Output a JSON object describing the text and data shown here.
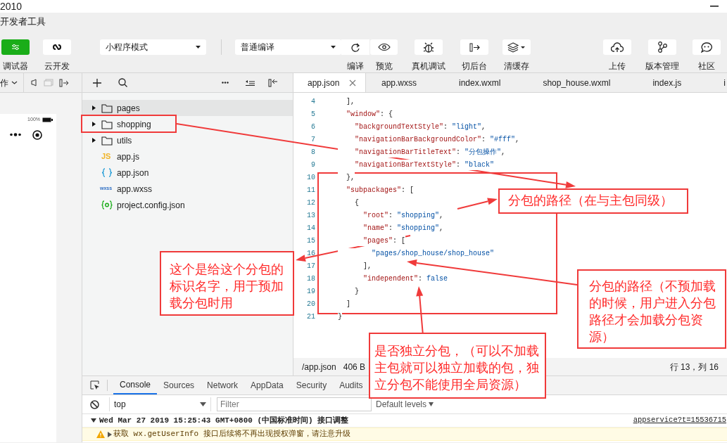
{
  "window": {
    "title": "2010",
    "app_title": "开发者工具"
  },
  "toolbar": {
    "toggles": [
      {
        "label": "调试器",
        "on": true
      },
      {
        "label": "云开发",
        "on": false
      }
    ],
    "mode_select": "小程序模式",
    "compile_select": "普通编译",
    "actions": [
      "编译",
      "预览",
      "真机调试",
      "切后台",
      "清缓存",
      "上传",
      "版本管理",
      "社区"
    ]
  },
  "simulator": {
    "header": "作",
    "battery": "100%"
  },
  "file_tree": {
    "items": [
      {
        "name": "pages",
        "kind": "folder",
        "expanded": false,
        "selected": true
      },
      {
        "name": "shopping",
        "kind": "folder",
        "expanded": false,
        "selected": false
      },
      {
        "name": "utils",
        "kind": "folder",
        "expanded": false,
        "selected": false
      },
      {
        "name": "app.js",
        "kind": "js",
        "icon_label": "JS",
        "selected": false
      },
      {
        "name": "app.json",
        "kind": "json",
        "selected": false
      },
      {
        "name": "app.wxss",
        "kind": "wxss",
        "icon_label": "wxss",
        "selected": false
      },
      {
        "name": "project.config.json",
        "kind": "config",
        "selected": false
      }
    ]
  },
  "editor": {
    "tabs": [
      {
        "label": "app.json",
        "selected": true
      },
      {
        "label": "app.wxss",
        "selected": false
      },
      {
        "label": "index.wxml",
        "selected": false
      },
      {
        "label": "shop_house.wxml",
        "selected": false
      },
      {
        "label": "index.js",
        "selected": false
      },
      {
        "label": "i",
        "selected": false
      }
    ],
    "lines": [
      {
        "number": "4",
        "tokens": [
          {
            "kind": "punct",
            "text": "  ],"
          }
        ]
      },
      {
        "number": "5",
        "tokens": [
          {
            "kind": "key",
            "text": "  \"window\""
          },
          {
            "kind": "punct",
            "text": ": {"
          }
        ]
      },
      {
        "number": "6",
        "tokens": [
          {
            "kind": "key",
            "text": "    \"backgroundTextStyle\""
          },
          {
            "kind": "punct",
            "text": ": "
          },
          {
            "kind": "string",
            "text": "\"light\""
          },
          {
            "kind": "punct",
            "text": ","
          }
        ]
      },
      {
        "number": "7",
        "tokens": [
          {
            "kind": "key",
            "text": "    \"navigationBarBackgroundColor\""
          },
          {
            "kind": "punct",
            "text": ": "
          },
          {
            "kind": "string",
            "text": "\"#fff\""
          },
          {
            "kind": "punct",
            "text": ","
          }
        ]
      },
      {
        "number": "8",
        "tokens": [
          {
            "kind": "key",
            "text": "    \"navigationBarTitleText\""
          },
          {
            "kind": "punct",
            "text": ": "
          },
          {
            "kind": "string",
            "text": "\"分包操作\""
          },
          {
            "kind": "punct",
            "text": ","
          }
        ]
      },
      {
        "number": "9",
        "tokens": [
          {
            "kind": "key",
            "text": "    \"navigationBarTextStyle\""
          },
          {
            "kind": "punct",
            "text": ": "
          },
          {
            "kind": "string",
            "text": "\"black\""
          }
        ]
      },
      {
        "number": "10",
        "tokens": [
          {
            "kind": "punct",
            "text": "  },"
          }
        ]
      },
      {
        "number": "11",
        "tokens": [
          {
            "kind": "key",
            "text": "  \"subpackages\""
          },
          {
            "kind": "punct",
            "text": ": ["
          }
        ]
      },
      {
        "number": "12",
        "tokens": [
          {
            "kind": "punct",
            "text": "    {"
          }
        ]
      },
      {
        "number": "13",
        "tokens": [
          {
            "kind": "key",
            "text": "      \"root\""
          },
          {
            "kind": "punct",
            "text": ": "
          },
          {
            "kind": "string",
            "text": "\"shopping\""
          },
          {
            "kind": "punct",
            "text": ","
          }
        ]
      },
      {
        "number": "14",
        "tokens": [
          {
            "kind": "key",
            "text": "      \"name\""
          },
          {
            "kind": "punct",
            "text": ": "
          },
          {
            "kind": "string",
            "text": "\"shopping\""
          },
          {
            "kind": "punct",
            "text": ","
          }
        ]
      },
      {
        "number": "15",
        "tokens": [
          {
            "kind": "key",
            "text": "      \"pages\""
          },
          {
            "kind": "punct",
            "text": ": ["
          }
        ]
      },
      {
        "number": "16",
        "tokens": [
          {
            "kind": "string",
            "text": "        \"pages/shop_house/shop_house\""
          }
        ]
      },
      {
        "number": "17",
        "tokens": [
          {
            "kind": "punct",
            "text": "      ],"
          }
        ]
      },
      {
        "number": "18",
        "tokens": [
          {
            "kind": "key",
            "text": "      \"independent\""
          },
          {
            "kind": "punct",
            "text": ": "
          },
          {
            "kind": "bool",
            "text": "false"
          }
        ]
      },
      {
        "number": "19",
        "tokens": [
          {
            "kind": "punct",
            "text": "    }"
          }
        ]
      },
      {
        "number": "20",
        "tokens": [
          {
            "kind": "punct",
            "text": "  ]"
          }
        ]
      },
      {
        "number": "21",
        "tokens": [
          {
            "kind": "punct",
            "text": "}"
          }
        ]
      }
    ],
    "status_bar": {
      "path": "/app.json",
      "size": "406 B",
      "cursor": "行 13，列 16"
    }
  },
  "devtools": {
    "tabs": [
      {
        "label": "Console",
        "selected": true
      },
      {
        "label": "Sources",
        "selected": false
      },
      {
        "label": "Network",
        "selected": false
      },
      {
        "label": "AppData",
        "selected": false
      },
      {
        "label": "Security",
        "selected": false
      },
      {
        "label": "Audits",
        "selected": false
      }
    ],
    "context": "top",
    "filter_placeholder": "Filter",
    "levels": "Default levels",
    "console": [
      {
        "kind": "group",
        "text": "Wed Mar 27 2019 15:25:43 GMT+0800 (中国标准时间) 接口调整",
        "source": "appservice?t=15536715"
      },
      {
        "kind": "warning",
        "text": "获取 wx.getUserInfo 接口后续将不再出现授权弹窗，请注意升级"
      }
    ]
  },
  "annotations": [
    {
      "text": "分包的路径（在与主包同级）"
    },
    {
      "text": "这个是给这个分包的标识名字，用于预加载分包时用"
    },
    {
      "text": "分包的路径（不预加载的时候，用户进入分包路径才会加载分包资源）"
    },
    {
      "text": "是否独立分包，（可以不加载主包就可以独立加载的包，独立分包不能使用全局资源）"
    }
  ]
}
